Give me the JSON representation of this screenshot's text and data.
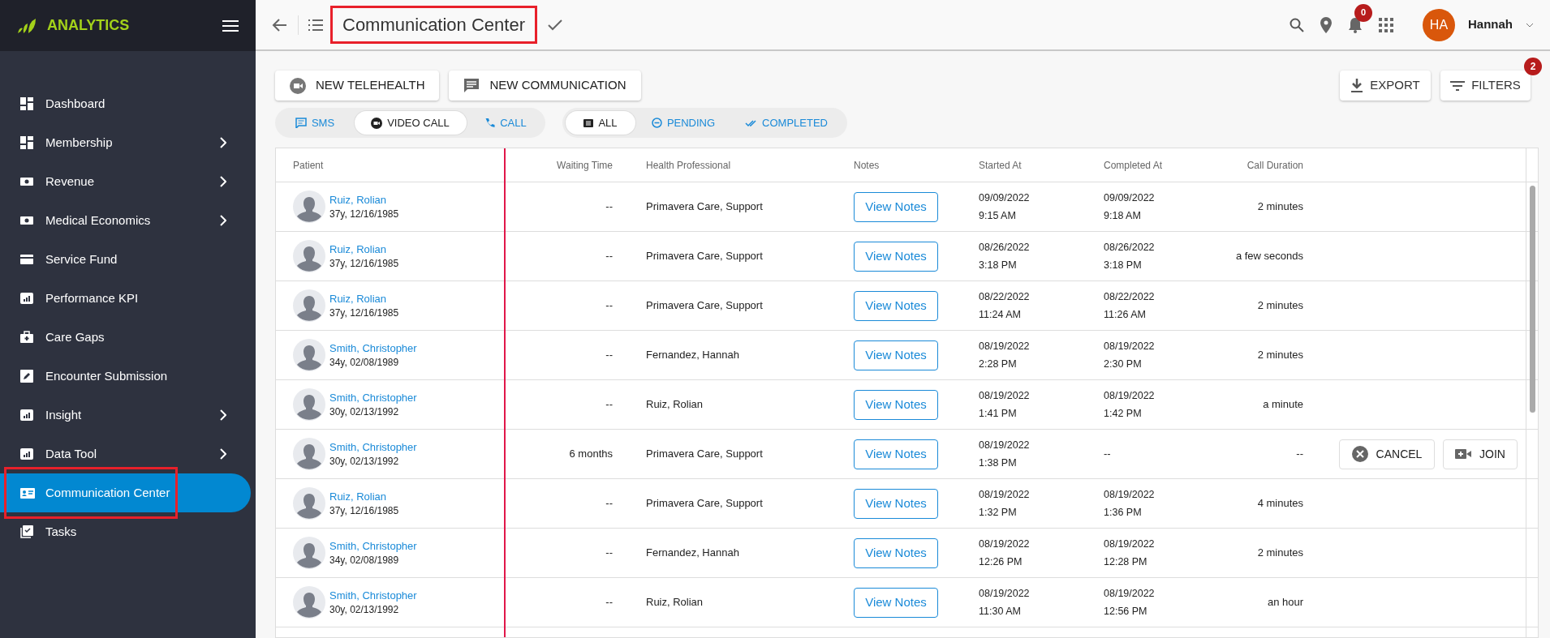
{
  "sidebar": {
    "brand": "ANALYTICS",
    "items": [
      {
        "label": "Dashboard",
        "expandable": false,
        "selected": false,
        "highlighted": false
      },
      {
        "label": "Membership",
        "expandable": true,
        "selected": false,
        "highlighted": false
      },
      {
        "label": "Revenue",
        "expandable": true,
        "selected": false,
        "highlighted": false
      },
      {
        "label": "Medical Economics",
        "expandable": true,
        "selected": false,
        "highlighted": false
      },
      {
        "label": "Service Fund",
        "expandable": false,
        "selected": false,
        "highlighted": false
      },
      {
        "label": "Performance KPI",
        "expandable": false,
        "selected": false,
        "highlighted": false
      },
      {
        "label": "Care Gaps",
        "expandable": false,
        "selected": false,
        "highlighted": false
      },
      {
        "label": "Encounter Submission",
        "expandable": false,
        "selected": false,
        "highlighted": false
      },
      {
        "label": "Insight",
        "expandable": true,
        "selected": false,
        "highlighted": false
      },
      {
        "label": "Data Tool",
        "expandable": true,
        "selected": false,
        "highlighted": false
      },
      {
        "label": "Communication Center",
        "expandable": false,
        "selected": true,
        "highlighted": true
      },
      {
        "label": "Tasks",
        "expandable": false,
        "selected": false,
        "highlighted": false
      }
    ]
  },
  "header": {
    "title": "Communication Center",
    "title_highlighted": true,
    "notification_count": "0",
    "avatar_initials": "HA",
    "user_name": "Hannah"
  },
  "toolbar": {
    "actions": [
      {
        "label": "NEW TELEHEALTH"
      },
      {
        "label": "NEW COMMUNICATION"
      }
    ],
    "export": "EXPORT",
    "filters": "FILTERS",
    "filter_count": "2",
    "type_tabs": [
      {
        "label": "SMS",
        "selected": false
      },
      {
        "label": "VIDEO CALL",
        "selected": true
      },
      {
        "label": "CALL",
        "selected": false
      }
    ],
    "status_tabs": [
      {
        "label": "ALL",
        "selected": true
      },
      {
        "label": "PENDING",
        "selected": false
      },
      {
        "label": "COMPLETED",
        "selected": false
      }
    ]
  },
  "table": {
    "columns": [
      "Patient",
      "Waiting Time",
      "Health Professional",
      "Notes",
      "Started At",
      "Completed At",
      "Call Duration"
    ],
    "rows": [
      {
        "name": "Ruiz, Rolian",
        "info": "37y, 12/16/1985",
        "waiting": "--",
        "professional": "Primavera Care, Support",
        "notes": "View Notes",
        "started_date": "09/09/2022",
        "started_time": "9:15 AM",
        "completed_date": "09/09/2022",
        "completed_time": "9:18 AM",
        "duration": "2 minutes"
      },
      {
        "name": "Ruiz, Rolian",
        "info": "37y, 12/16/1985",
        "waiting": "--",
        "professional": "Primavera Care, Support",
        "notes": "View Notes",
        "started_date": "08/26/2022",
        "started_time": "3:18 PM",
        "completed_date": "08/26/2022",
        "completed_time": "3:18 PM",
        "duration": "a few seconds"
      },
      {
        "name": "Ruiz, Rolian",
        "info": "37y, 12/16/1985",
        "waiting": "--",
        "professional": "Primavera Care, Support",
        "notes": "View Notes",
        "started_date": "08/22/2022",
        "started_time": "11:24 AM",
        "completed_date": "08/22/2022",
        "completed_time": "11:26 AM",
        "duration": "2 minutes"
      },
      {
        "name": "Smith, Christopher",
        "info": "34y, 02/08/1989",
        "waiting": "--",
        "professional": "Fernandez, Hannah",
        "notes": "View Notes",
        "started_date": "08/19/2022",
        "started_time": "2:28 PM",
        "completed_date": "08/19/2022",
        "completed_time": "2:30 PM",
        "duration": "2 minutes"
      },
      {
        "name": "Smith, Christopher",
        "info": "30y, 02/13/1992",
        "waiting": "--",
        "professional": "Ruiz, Rolian",
        "notes": "View Notes",
        "started_date": "08/19/2022",
        "started_time": "1:41 PM",
        "completed_date": "08/19/2022",
        "completed_time": "1:42 PM",
        "duration": "a minute"
      },
      {
        "name": "Smith, Christopher",
        "info": "30y, 02/13/1992",
        "waiting": "6 months",
        "professional": "Primavera Care, Support",
        "notes": "View Notes",
        "started_date": "08/19/2022",
        "started_time": "1:38 PM",
        "completed": "--",
        "duration": "--",
        "cancel": "CANCEL",
        "join": "JOIN"
      },
      {
        "name": "Ruiz, Rolian",
        "info": "37y, 12/16/1985",
        "waiting": "--",
        "professional": "Primavera Care, Support",
        "notes": "View Notes",
        "started_date": "08/19/2022",
        "started_time": "1:32 PM",
        "completed_date": "08/19/2022",
        "completed_time": "1:36 PM",
        "duration": "4 minutes"
      },
      {
        "name": "Smith, Christopher",
        "info": "34y, 02/08/1989",
        "waiting": "--",
        "professional": "Fernandez, Hannah",
        "notes": "View Notes",
        "started_date": "08/19/2022",
        "started_time": "12:26 PM",
        "completed_date": "08/19/2022",
        "completed_time": "12:28 PM",
        "duration": "2 minutes"
      },
      {
        "name": "Smith, Christopher",
        "info": "30y, 02/13/1992",
        "waiting": "--",
        "professional": "Ruiz, Rolian",
        "notes": "View Notes",
        "started_date": "08/19/2022",
        "started_time": "11:30 AM",
        "completed_date": "08/19/2022",
        "completed_time": "12:56 PM",
        "duration": "an hour"
      }
    ]
  }
}
